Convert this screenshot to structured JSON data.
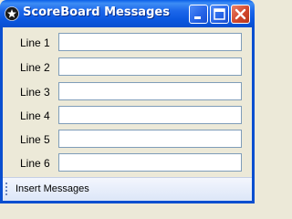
{
  "window": {
    "title": "ScoreBoard Messages",
    "controls": {
      "minimize": "minimize",
      "maximize": "maximize",
      "close": "close"
    }
  },
  "form": {
    "rows": [
      {
        "label": "Line 1",
        "value": ""
      },
      {
        "label": "Line 2",
        "value": ""
      },
      {
        "label": "Line 3",
        "value": ""
      },
      {
        "label": "Line 4",
        "value": ""
      },
      {
        "label": "Line 5",
        "value": ""
      },
      {
        "label": "Line 6",
        "value": ""
      }
    ]
  },
  "toolbar": {
    "insert_label": "Insert Messages"
  },
  "colors": {
    "titlebar": "#0a5ee9",
    "close": "#d2472c",
    "field_border": "#7f9db9",
    "background": "#ece9d8"
  }
}
